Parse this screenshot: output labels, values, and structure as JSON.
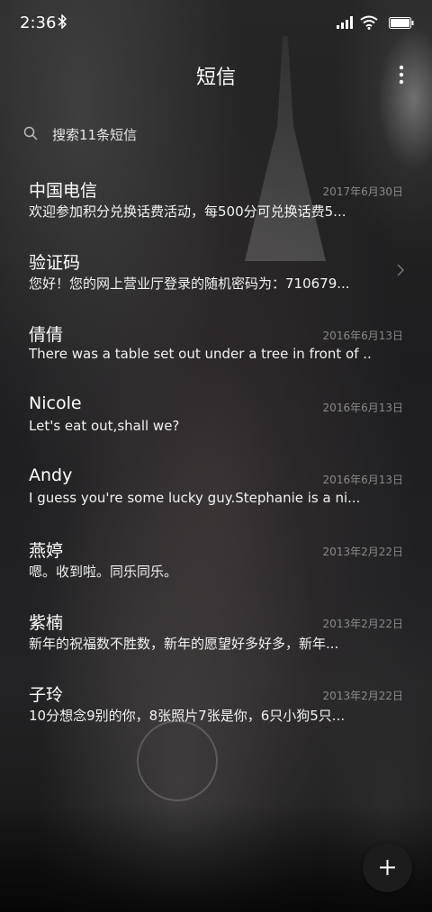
{
  "status_bar": {
    "time": "2:36"
  },
  "header": {
    "title": "短信"
  },
  "search": {
    "placeholder": "搜索11条短信"
  },
  "messages": [
    {
      "name": "中国电信",
      "date": "2017年6月30日",
      "preview": "欢迎参加积分兑换话费活动，每500分可兑换话费5..."
    },
    {
      "name": "验证码",
      "date": "",
      "preview": "您好！您的网上营业厅登录的随机密码为：710679..."
    },
    {
      "name": "倩倩",
      "date": "2016年6月13日",
      "preview": "There was a table set out under a tree in front of ..."
    },
    {
      "name": "Nicole",
      "date": "2016年6月13日",
      "preview": "Let's eat out,shall we?"
    },
    {
      "name": "Andy",
      "date": "2016年6月13日",
      "preview": "I guess you're some lucky guy.Stephanie is a ni..."
    },
    {
      "name": "燕婷",
      "date": "2013年2月22日",
      "preview": "嗯。收到啦。同乐同乐。"
    },
    {
      "name": "紫楠",
      "date": "2013年2月22日",
      "preview": "新年的祝福数不胜数，新年的愿望好多好多，新年..."
    },
    {
      "name": "子玲",
      "date": "2013年2月22日",
      "preview": "10分想念9别的你，8张照片7张是你，6只小狗5只..."
    }
  ],
  "icons": {
    "bluetooth": "bluetooth-icon",
    "signal": "signal-icon",
    "wifi": "wifi-icon",
    "battery": "battery-icon",
    "menu": "more-vertical-icon",
    "search": "search-icon",
    "chevron": "chevron-right-icon",
    "add": "plus-icon"
  }
}
